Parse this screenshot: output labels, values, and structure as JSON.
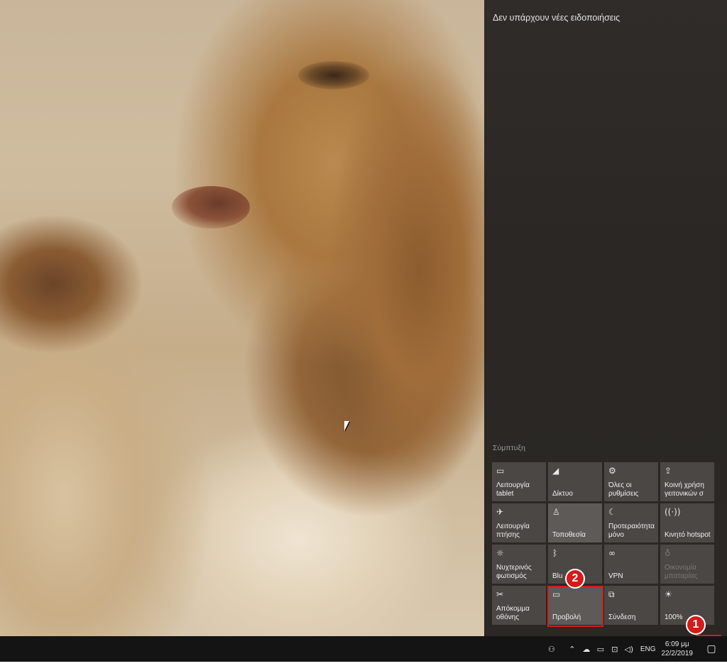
{
  "action_center": {
    "no_notifications": "Δεν υπάρχουν νέες ειδοποιήσεις",
    "collapse": "Σύμπτυξη",
    "tiles": [
      {
        "label": "Λειτουργία\ntablet",
        "icon": "tablet-mode-icon"
      },
      {
        "label": "Δίκτυο",
        "icon": "network-icon"
      },
      {
        "label": "Όλες οι\nρυθμίσεις",
        "icon": "settings-icon"
      },
      {
        "label": "Κοινή χρήση\nγειτονικών σ",
        "icon": "nearby-share-icon"
      },
      {
        "label": "Λειτουργία\nπτήσης",
        "icon": "airplane-icon"
      },
      {
        "label": "Τοποθεσία",
        "icon": "location-icon"
      },
      {
        "label": "Προτεραιότητα\nμόνο",
        "icon": "moon-icon"
      },
      {
        "label": "Κινητό hotspot",
        "icon": "hotspot-icon"
      },
      {
        "label": "Νυχτερινός\nφωτισμός",
        "icon": "night-light-icon"
      },
      {
        "label": "Blu",
        "icon": "bluetooth-icon"
      },
      {
        "label": "VPN",
        "icon": "vpn-icon"
      },
      {
        "label": "Οικονομία\nμπαταρίας",
        "icon": "battery-saver-icon"
      },
      {
        "label": "Απόκομμα\nοθόνης",
        "icon": "screen-snip-icon"
      },
      {
        "label": "Προβολή",
        "icon": "project-icon"
      },
      {
        "label": "Σύνδεση",
        "icon": "connect-icon"
      },
      {
        "label": "100%",
        "icon": "brightness-icon"
      }
    ]
  },
  "annotations": {
    "badge_1": "1",
    "badge_2": "2"
  },
  "taskbar": {
    "language": "ENG",
    "time": "6:09 μμ",
    "date": "22/2/2019"
  },
  "colors": {
    "panel_bg": "#2b2825",
    "tile_bg": "#4a4744",
    "annotation_red": "#d31b1b",
    "taskbar_bg": "#141414"
  }
}
